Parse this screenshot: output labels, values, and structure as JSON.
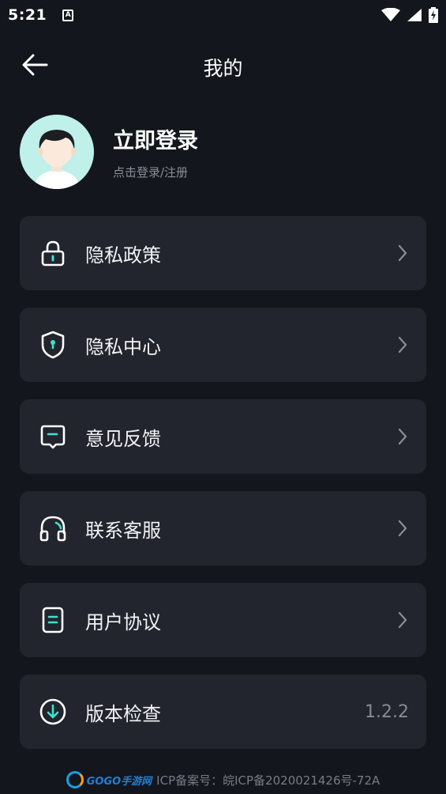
{
  "status_bar": {
    "time": "5:21",
    "notification_icon": "a-notification-icon",
    "icons": [
      "wifi-icon",
      "signal-icon",
      "battery-charging-icon"
    ]
  },
  "header": {
    "title": "我的",
    "back_icon": "arrow-left-icon"
  },
  "profile": {
    "title": "立即登录",
    "subtitle": "点击登录/注册"
  },
  "menu": {
    "items": [
      {
        "label": "隐私政策",
        "icon": "lock-icon"
      },
      {
        "label": "隐私中心",
        "icon": "shield-icon"
      },
      {
        "label": "意见反馈",
        "icon": "feedback-icon"
      },
      {
        "label": "联系客服",
        "icon": "headset-icon"
      },
      {
        "label": "用户协议",
        "icon": "document-icon"
      },
      {
        "label": "版本检查",
        "icon": "download-icon",
        "value": "1.2.2"
      }
    ]
  },
  "footer": {
    "watermark": "GOGO手游网",
    "text": "ICP备案号：皖ICP备2020021426号-72A"
  },
  "colors": {
    "background": "#14161d",
    "card": "#22252e",
    "accent": "#3fe0d0",
    "muted": "#8a8e99"
  }
}
